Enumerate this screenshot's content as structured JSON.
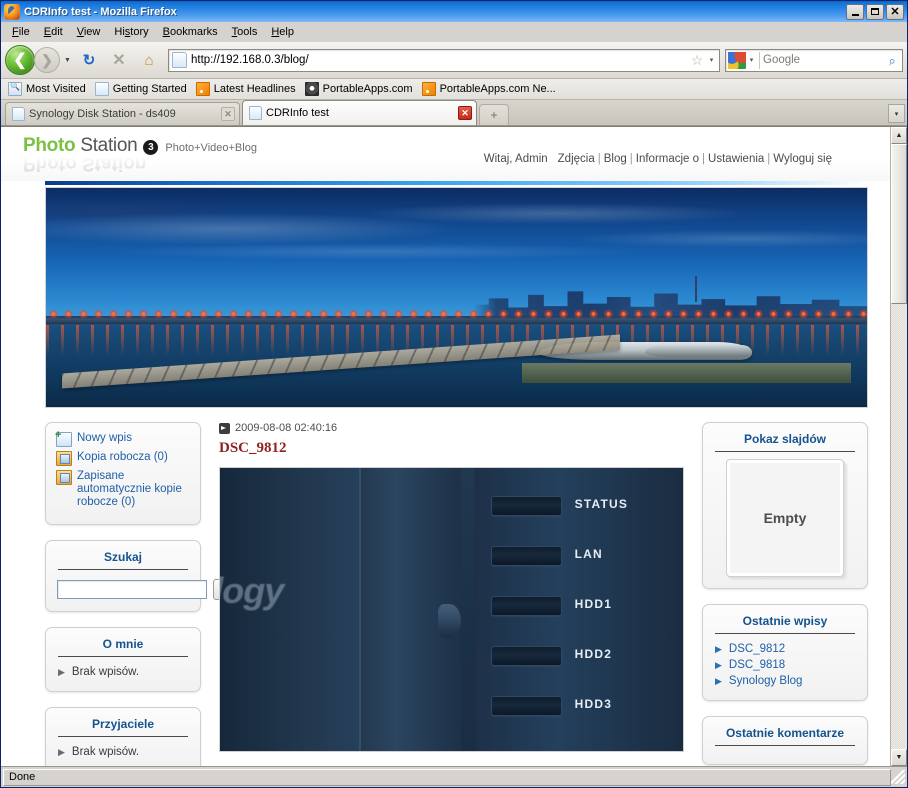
{
  "window": {
    "title": "CDRInfo test - Mozilla Firefox",
    "minimize_label": "Minimize",
    "maximize_label": "Maximize",
    "close_label": "Close"
  },
  "menu": [
    {
      "label": "File",
      "accel": "F"
    },
    {
      "label": "Edit",
      "accel": "E"
    },
    {
      "label": "View",
      "accel": "V"
    },
    {
      "label": "History",
      "accel": "s"
    },
    {
      "label": "Bookmarks",
      "accel": "B"
    },
    {
      "label": "Tools",
      "accel": "T"
    },
    {
      "label": "Help",
      "accel": "H"
    }
  ],
  "toolbar": {
    "back_label": "❮",
    "forward_label": "❯",
    "history_dropdown": "▼",
    "reload_label": "↻",
    "stop_label": "✕",
    "home_label": "⌂",
    "url": "http://192.168.0.3/blog/",
    "bookmark_star": "☆",
    "url_dropdown": "▾",
    "search_placeholder": "Google",
    "search_engine": "Google",
    "search_go": "⌕",
    "search_dropdown": "▾"
  },
  "bookmarks": [
    {
      "label": "Most Visited",
      "icon": "star-folder-icon"
    },
    {
      "label": "Getting Started",
      "icon": "page-icon"
    },
    {
      "label": "Latest Headlines",
      "icon": "rss-icon"
    },
    {
      "label": "PortableApps.com",
      "icon": "portableapps-icon"
    },
    {
      "label": "PortableApps.com Ne...",
      "icon": "rss-icon"
    }
  ],
  "tabs": [
    {
      "title": "Synology Disk Station - ds409",
      "active": false,
      "close_label": "✕"
    },
    {
      "title": "CDRInfo test",
      "active": true,
      "close_label": "✕"
    }
  ],
  "tab_new_label": "+",
  "tab_list_label": "▾",
  "page": {
    "logo": {
      "word1": "Photo",
      "word2": "Station",
      "version": "3",
      "tagline": "Photo+Video+Blog"
    },
    "nav": {
      "greeting": "Witaj, Admin",
      "links": [
        "Zdjęcia",
        "Blog",
        "Informacje o",
        "Ustawienia",
        "Wyloguj się"
      ],
      "separator": "|"
    },
    "banner_alt": "Night harbor panorama with bridge and city lights",
    "blog_actions": [
      {
        "label": "Nowy wpis",
        "icon": "new-page-icon"
      },
      {
        "label": "Kopia robocza (0)",
        "icon": "folder-draft-icon"
      },
      {
        "label": "Zapisane automatycznie kopie robocze (0)",
        "icon": "folder-autosave-icon"
      }
    ],
    "search_card": {
      "title": "Szukaj",
      "value": "",
      "placeholder": "",
      "button_icon": "search-magnifier-icon"
    },
    "about_card": {
      "title": "O mnie",
      "empty_text": "Brak wpisów."
    },
    "friends_card": {
      "title": "Przyjaciele",
      "empty_text": "Brak wpisów."
    },
    "slideshow_card": {
      "title": "Pokaz slajdów",
      "empty_text": "Empty"
    },
    "recent_posts_card": {
      "title": "Ostatnie wpisy",
      "items": [
        "DSC_9812",
        "DSC_9818",
        "Synology Blog"
      ]
    },
    "recent_comments_card": {
      "title": "Ostatnie komentarze"
    },
    "post": {
      "timestamp": "2009-08-08 02:40:16",
      "title": "DSC_9812",
      "image_alt": "Close-up of a Synology NAS front panel",
      "led_labels": [
        "STATUS",
        "LAN",
        "HDD1",
        "HDD2",
        "HDD3"
      ],
      "brand_text": "ology"
    }
  },
  "statusbar": {
    "text": "Done"
  },
  "colors": {
    "accent_green": "#7bc144",
    "card_title_blue": "#14538f",
    "link_blue": "#1f5fa8",
    "post_title_red": "#8f2323",
    "titlebar_blue": "#2b87e6"
  }
}
